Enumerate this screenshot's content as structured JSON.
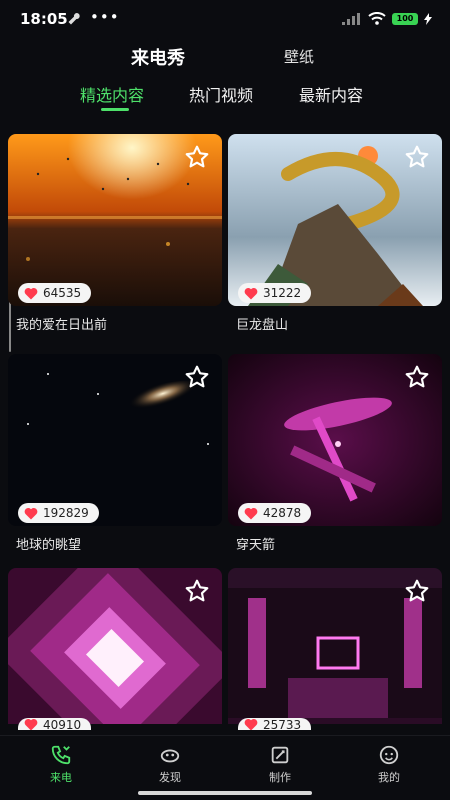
{
  "status": {
    "time": "18:05",
    "dots": "•••",
    "battery": "100"
  },
  "top_tabs": [
    {
      "label": "来电秀"
    },
    {
      "label": "壁纸"
    }
  ],
  "category_tabs": [
    {
      "label": "精选内容"
    },
    {
      "label": "热门视频"
    },
    {
      "label": "最新内容"
    }
  ],
  "items": [
    {
      "title": "我的爱在日出前",
      "likes": "64535",
      "scene": "sunset-sea"
    },
    {
      "title": "巨龙盘山",
      "likes": "31222",
      "scene": "golden-dragon-mountain"
    },
    {
      "title": "地球的眺望",
      "likes": "192829",
      "scene": "earth-galaxy"
    },
    {
      "title": "穿天箭",
      "likes": "42878",
      "scene": "pink-sword"
    },
    {
      "title": "",
      "likes": "40910",
      "scene": "pink-tunnel"
    },
    {
      "title": "",
      "likes": "25733",
      "scene": "neon-room"
    }
  ],
  "bottom_nav": [
    {
      "label": "来电",
      "icon": "phone-icon",
      "active": true
    },
    {
      "label": "发现",
      "icon": "discover-icon",
      "active": false
    },
    {
      "label": "制作",
      "icon": "make-icon",
      "active": false
    },
    {
      "label": "我的",
      "icon": "profile-icon",
      "active": false
    }
  ],
  "colors": {
    "accent": "#4ee06a",
    "background": "#0b0c10"
  }
}
